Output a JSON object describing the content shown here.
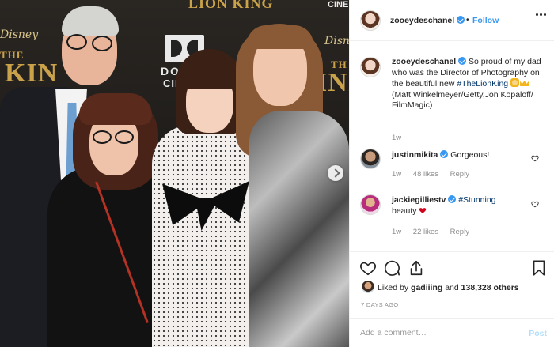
{
  "post": {
    "image_alt": "Photo of four people posing at a red carpet premiere",
    "backdrop": {
      "brand_top": "LION KING",
      "cinema_label": "CINE",
      "dolby_text": "DO",
      "dolby_sub": "CINE",
      "disney_left": "Disney",
      "disney_right": "Disn",
      "title_left": "THE",
      "title_left_big": "KIN",
      "title_right_small": "TH",
      "title_right_big": "INI"
    }
  },
  "header": {
    "username": "zooeydeschanel",
    "separator": "•",
    "follow_label": "Follow"
  },
  "caption": {
    "username": "zooeydeschanel",
    "text_before_tag": "So proud of my dad who was the Director of Photography on the beautiful new",
    "hashtag": "#TheLionKing",
    "text_after_emoji": "(Matt Winkelmeyer/Getty,Jon Kopaloff/ FilmMagic)",
    "age": "1w"
  },
  "comments": [
    {
      "username": "justinmikita",
      "text": "Gorgeous!",
      "age": "1w",
      "likes": "48 likes",
      "reply": "Reply"
    },
    {
      "username": "jackiegilliestv",
      "hashtag": "#Stunning",
      "text": "beauty",
      "age": "1w",
      "likes": "22 likes",
      "reply": "Reply"
    }
  ],
  "actions": {
    "liked_prefix": "Liked by",
    "liked_user": "gadiiing",
    "liked_and": "and",
    "liked_others": "138,328 others",
    "date": "7 DAYS AGO",
    "comment_placeholder": "Add a comment…",
    "post_label": "Post"
  },
  "icons": {
    "verified": "verified-badge-icon",
    "more": "more-options-icon",
    "heart": "heart-icon",
    "comment": "comment-icon",
    "share": "share-icon",
    "bookmark": "bookmark-icon",
    "carousel_next": "chevron-right-icon"
  },
  "colors": {
    "link_blue": "#3897f0",
    "hashtag_navy": "#003569",
    "text_primary": "#262626",
    "text_secondary": "#8e8e8e",
    "heart_red": "#ed4956"
  }
}
